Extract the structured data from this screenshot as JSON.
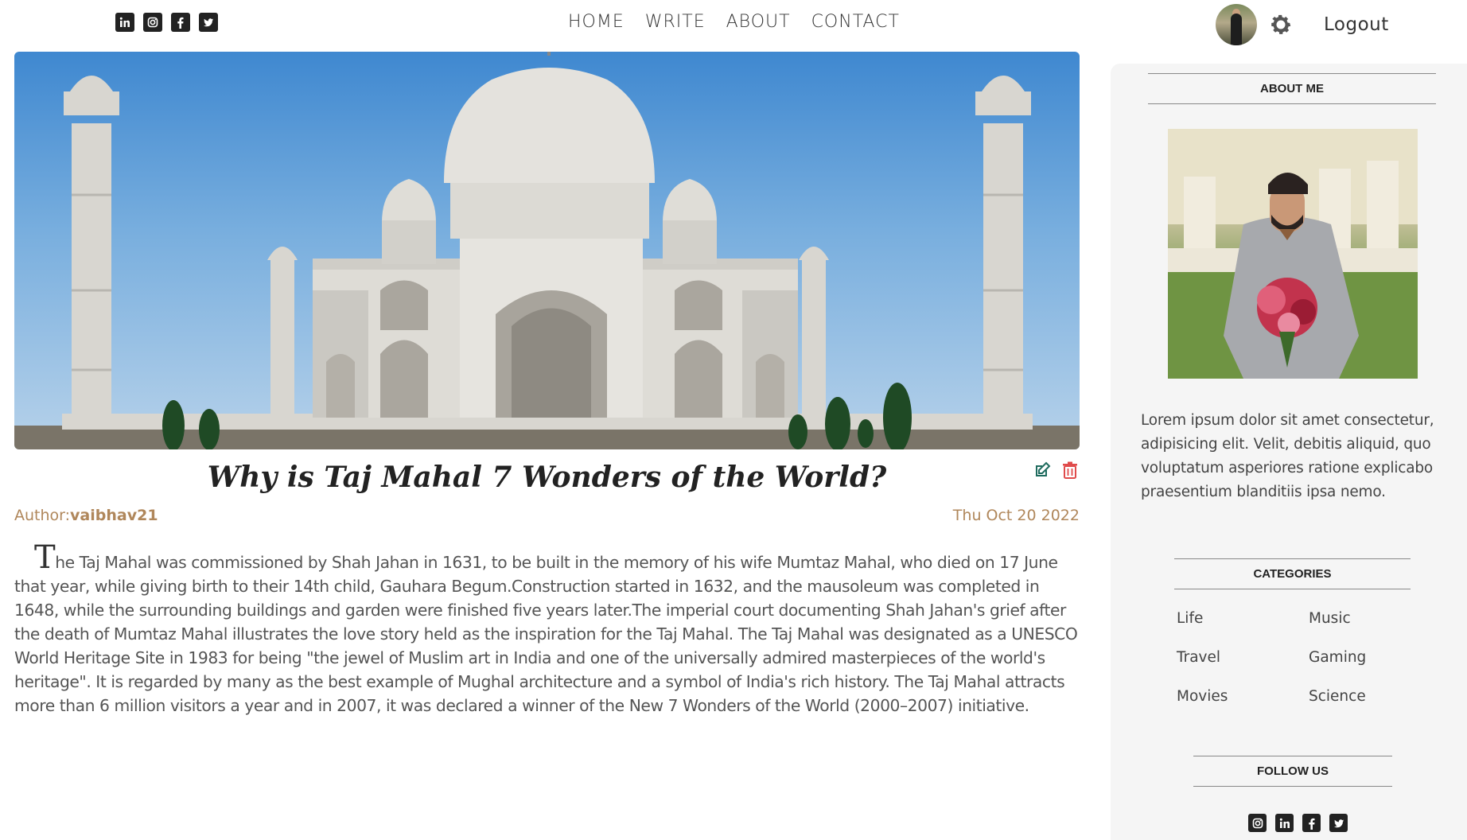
{
  "header": {
    "social_icons": [
      "linkedin-icon",
      "instagram-icon",
      "facebook-icon",
      "twitter-icon"
    ],
    "nav": [
      {
        "label": "HOME"
      },
      {
        "label": "WRITE"
      },
      {
        "label": "ABOUT"
      },
      {
        "label": "CONTACT"
      }
    ],
    "logout_label": "Logout",
    "settings_icon": "gear-icon"
  },
  "post": {
    "title": "Why is Taj Mahal 7 Wonders of the World?",
    "author_label": "Author:",
    "author_name": "vaibhav21",
    "date": "Thu Oct 20 2022",
    "body_first_letter": "T",
    "body_rest": "he Taj Mahal was commissioned by Shah Jahan in 1631, to be built in the memory of his wife Mumtaz Mahal, who died on 17 June that year, while giving birth to their 14th child, Gauhara Begum.Construction started in 1632, and the mausoleum was completed in 1648, while the surrounding buildings and garden were finished five years later.The imperial court documenting Shah Jahan's grief after the death of Mumtaz Mahal illustrates the love story held as the inspiration for the Taj Mahal. The Taj Mahal was designated as a UNESCO World Heritage Site in 1983 for being \"the jewel of Muslim art in India and one of the universally admired masterpieces of the world's heritage\". It is regarded by many as the best example of Mughal architecture and a symbol of India's rich history. The Taj Mahal attracts more than 6 million visitors a year and in 2007, it was declared a winner of the New 7 Wonders of the World (2000–2007) initiative.",
    "edit_icon": "edit-icon",
    "delete_icon": "trash-icon",
    "edit_color": "#1f6b5e",
    "delete_color": "#e04b4b"
  },
  "sidebar": {
    "about_title": "ABOUT ME",
    "about_text": "Lorem ipsum dolor sit amet consectetur, adipisicing elit. Velit, debitis aliquid, quo voluptatum asperiores ratione explicabo praesentium blanditiis ipsa nemo.",
    "categories_title": "CATEGORIES",
    "categories": [
      "Life",
      "Music",
      "Travel",
      "Gaming",
      "Movies",
      "Science"
    ],
    "follow_title": "FOLLOW US",
    "follow_icons": [
      "instagram-icon",
      "linkedin-icon",
      "facebook-icon",
      "twitter-icon"
    ]
  },
  "colors": {
    "accent_brown": "#b0875b",
    "sidebar_bg": "#f5f5f5",
    "text": "#444444"
  }
}
